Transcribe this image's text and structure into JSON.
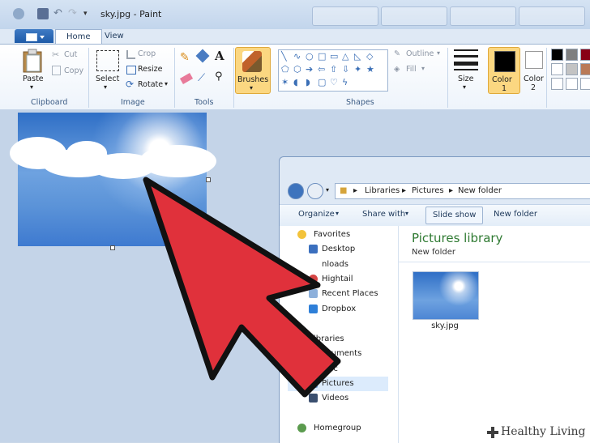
{
  "window": {
    "title": "sky.jpg - Paint"
  },
  "tabs": [
    {
      "label": "Home"
    },
    {
      "label": "View"
    }
  ],
  "clipboard": {
    "paste": "Paste",
    "cut": "Cut",
    "copy": "Copy",
    "group": "Clipboard"
  },
  "image": {
    "select": "Select",
    "crop": "Crop",
    "resize": "Resize",
    "rotate": "Rotate",
    "group": "Image"
  },
  "tools": {
    "group": "Tools"
  },
  "brushes": {
    "label": "Brushes"
  },
  "shapes": {
    "outline": "Outline",
    "fill": "Fill",
    "group": "Shapes"
  },
  "size": {
    "label": "Size"
  },
  "colors": {
    "color1": "Color",
    "color1_num": "1",
    "color2": "Color",
    "color2_num": "2",
    "palette": [
      "#000000",
      "#7f7f7f",
      "#ffffff",
      "#c3c3c3",
      "#ffffff",
      "#ffffff"
    ]
  },
  "explorer": {
    "breadcrumb": [
      "Libraries",
      "Pictures",
      "New folder"
    ],
    "commands": {
      "organize": "Organize",
      "share": "Share with",
      "slideshow": "Slide show",
      "newfolder": "New folder"
    },
    "nav": [
      {
        "label": "Favorites"
      },
      {
        "label": "Desktop"
      },
      {
        "label": "nloads"
      },
      {
        "label": "Hightail"
      },
      {
        "label": "Recent Places"
      },
      {
        "label": "Dropbox"
      },
      {
        "label": "ibraries"
      },
      {
        "label": "ocuments"
      },
      {
        "label": "usic"
      },
      {
        "label": "Pictures"
      },
      {
        "label": "Videos"
      },
      {
        "label": "Homegroup"
      }
    ],
    "library_title": "Pictures library",
    "library_sub": "New folder",
    "file": {
      "name": "sky.jpg"
    }
  },
  "watermark": {
    "text": "Healthy Living"
  },
  "accent": {
    "arrow": "#e0313b",
    "ribbon_highlight": "#fbd781"
  }
}
